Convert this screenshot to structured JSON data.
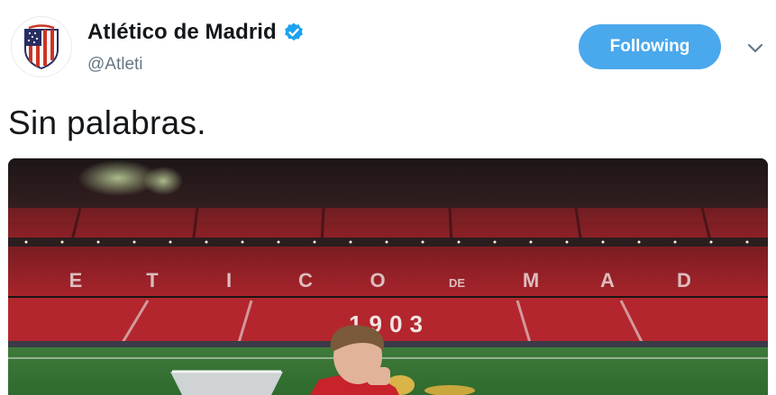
{
  "tweet": {
    "author": {
      "display_name": "Atlético de Madrid",
      "handle": "@Atleti",
      "verified": true,
      "avatar_icon": "atletico-crest-icon"
    },
    "follow_button_label": "Following",
    "more_icon": "chevron-down-icon",
    "text": "Sin palabras.",
    "media": {
      "stand_letters": [
        "E",
        "T",
        "I",
        "C",
        "O",
        "DE",
        "M",
        "A",
        "D"
      ],
      "seat_number": "1903"
    }
  },
  "colors": {
    "verified": "#1da1f2",
    "follow_button": "#4aa8ec",
    "handle": "#657786",
    "crest_red": "#cb3524",
    "crest_blue": "#272e61"
  }
}
